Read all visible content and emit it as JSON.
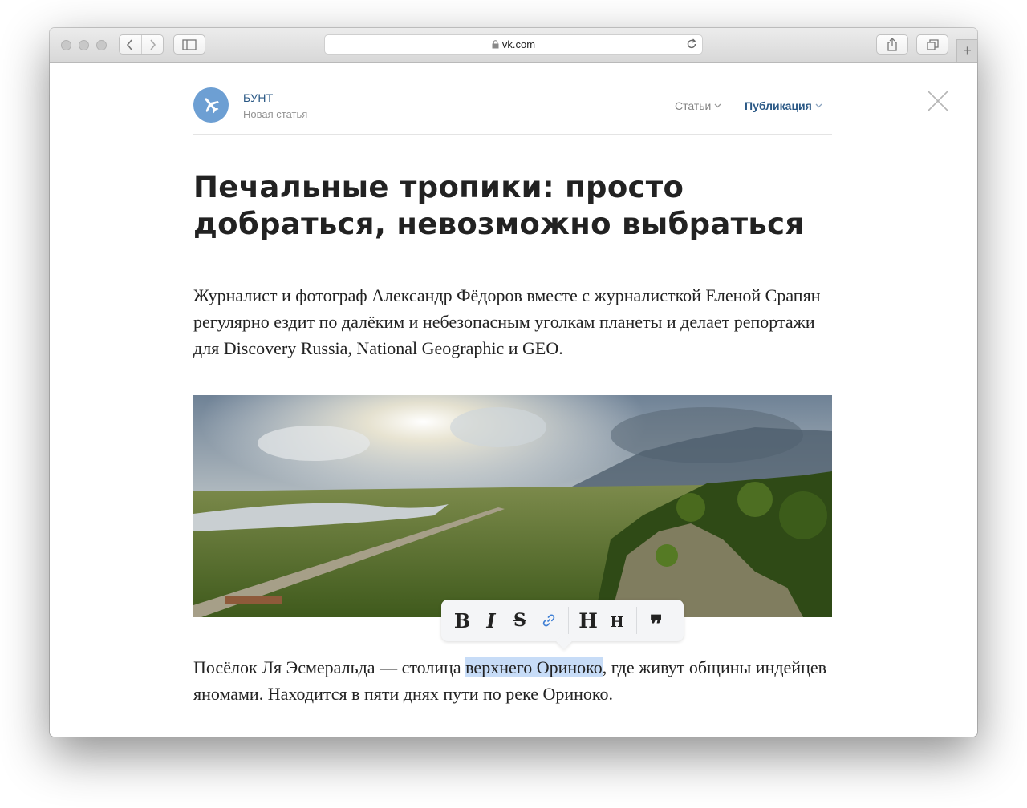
{
  "browser": {
    "url": "vk.com"
  },
  "header": {
    "club_name": "БУНТ",
    "club_subtitle": "Новая статья",
    "menu_articles": "Статьи",
    "menu_publish": "Публикация"
  },
  "article": {
    "title": "Печальные тропики: просто добраться, невозможно выбраться",
    "lead": "Журналист и фотограф Александр Фёдоров вместе с журналисткой Еленой Срапян регулярно ездит по далёким и небезопасным уголкам планеты и делает репортажи для Discovery Russia, National Geographic и GEO.",
    "paragraph_before": "Посёлок Ля Эсмеральда — столица ",
    "paragraph_selected": "верхнего Ориноко",
    "paragraph_after": ", где живут общины индейцев яномами. Находится в пяти днях пути по реке Ориноко."
  },
  "format_toolbar": {
    "bold": "B",
    "italic": "I",
    "strike": "S",
    "heading": "H",
    "subheading": "H",
    "quote": "❞",
    "link_color": "#3f7fd4"
  },
  "colors": {
    "brand_blue": "#2a5885",
    "avatar": "#6d9fd3",
    "selection": "#c7dcf7"
  }
}
